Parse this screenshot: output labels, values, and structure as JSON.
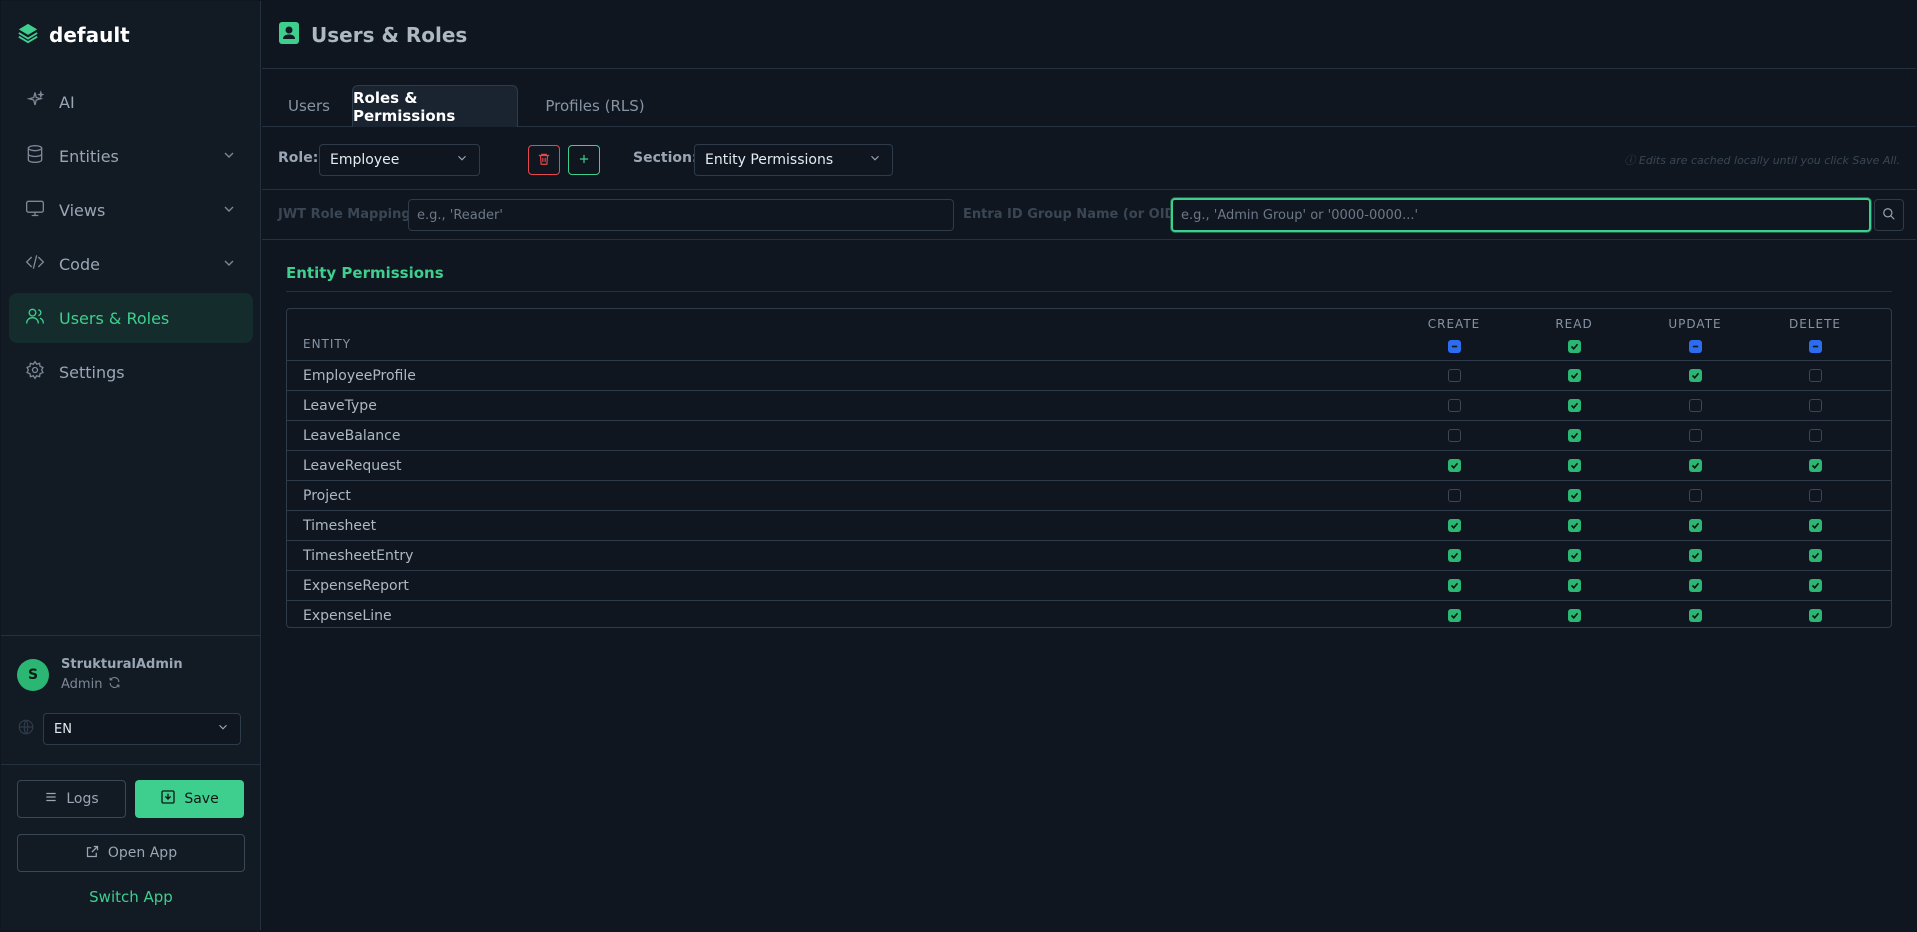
{
  "app": {
    "name": "default"
  },
  "sidebar": {
    "items": [
      {
        "label": "AI",
        "icon": "sparkles-icon",
        "chevron": false
      },
      {
        "label": "Entities",
        "icon": "database-icon",
        "chevron": true
      },
      {
        "label": "Views",
        "icon": "monitor-icon",
        "chevron": true
      },
      {
        "label": "Code",
        "icon": "code-icon",
        "chevron": true
      },
      {
        "label": "Users & Roles",
        "icon": "users-icon",
        "chevron": false,
        "active": true
      },
      {
        "label": "Settings",
        "icon": "gear-icon",
        "chevron": false
      }
    ],
    "user": {
      "initial": "S",
      "name": "StrukturalAdmin",
      "role": "Admin"
    },
    "language": {
      "value": "EN"
    },
    "logs_label": "Logs",
    "save_label": "Save",
    "open_app_label": "Open App",
    "switch_app_label": "Switch App"
  },
  "header": {
    "title": "Users & Roles"
  },
  "tabs": [
    {
      "label": "Users",
      "active": false
    },
    {
      "label": "Roles & Permissions",
      "active": true
    },
    {
      "label": "Profiles (RLS)",
      "active": false
    }
  ],
  "toolbar": {
    "role_label": "Role:",
    "role_value": "Employee",
    "section_label": "Section:",
    "section_value": "Entity Permissions",
    "hint": "ⓘ Edits are cached locally until you click Save All."
  },
  "mapping": {
    "jwt_label": "JWT Role Mapping",
    "jwt_placeholder": "e.g., 'Reader'",
    "entra_label": "Entra ID Group Name (or OID)",
    "entra_placeholder": "e.g., 'Admin Group' or '0000-0000...'"
  },
  "section_title": "Entity Permissions",
  "table": {
    "entity_header": "ENTITY",
    "columns": [
      "CREATE",
      "READ",
      "UPDATE",
      "DELETE"
    ],
    "header_states": [
      "mixed",
      "on",
      "mixed",
      "mixed"
    ],
    "rows": [
      {
        "name": "EmployeeProfile",
        "perms": [
          false,
          true,
          true,
          false
        ]
      },
      {
        "name": "LeaveType",
        "perms": [
          false,
          true,
          false,
          false
        ]
      },
      {
        "name": "LeaveBalance",
        "perms": [
          false,
          true,
          false,
          false
        ]
      },
      {
        "name": "LeaveRequest",
        "perms": [
          true,
          true,
          true,
          true
        ]
      },
      {
        "name": "Project",
        "perms": [
          false,
          true,
          false,
          false
        ]
      },
      {
        "name": "Timesheet",
        "perms": [
          true,
          true,
          true,
          true
        ]
      },
      {
        "name": "TimesheetEntry",
        "perms": [
          true,
          true,
          true,
          true
        ]
      },
      {
        "name": "ExpenseReport",
        "perms": [
          true,
          true,
          true,
          true
        ]
      },
      {
        "name": "ExpenseLine",
        "perms": [
          true,
          true,
          true,
          true
        ]
      }
    ]
  },
  "colors": {
    "accent": "#3ecf8e",
    "danger": "#e5484d",
    "info": "#2b6cf0",
    "background": "#0f1620"
  }
}
